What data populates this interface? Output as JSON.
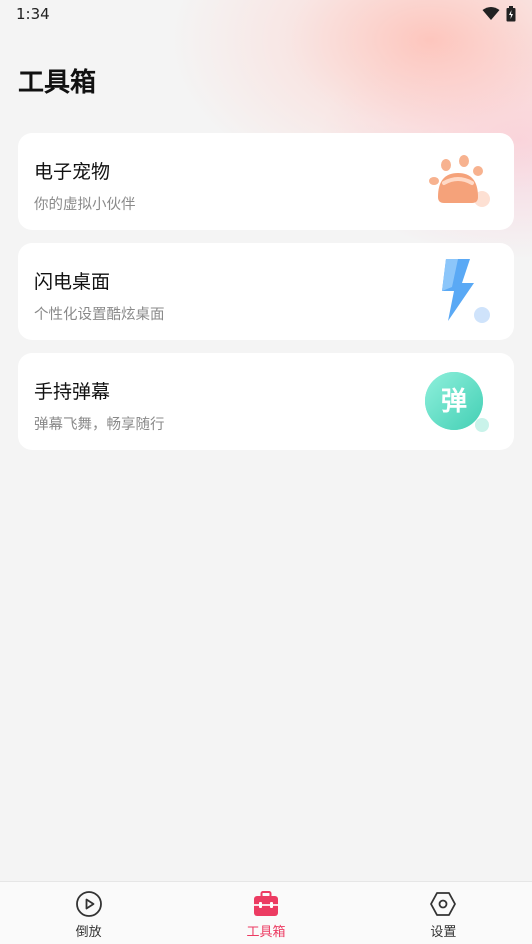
{
  "status": {
    "time": "1:34"
  },
  "page": {
    "title": "工具箱"
  },
  "tools": [
    {
      "title": "电子宠物",
      "subtitle": "你的虚拟小伙伴",
      "icon": "paw-icon"
    },
    {
      "title": "闪电桌面",
      "subtitle": "个性化设置酷炫桌面",
      "icon": "lightning-icon"
    },
    {
      "title": "手持弹幕",
      "subtitle": "弹幕飞舞，畅享随行",
      "icon": "danmu-icon",
      "icon_text": "弹"
    }
  ],
  "tabs": [
    {
      "label": "倒放",
      "icon": "play-circle-icon",
      "active": false
    },
    {
      "label": "工具箱",
      "icon": "toolbox-icon",
      "active": true
    },
    {
      "label": "设置",
      "icon": "hexagon-settings-icon",
      "active": false
    }
  ],
  "colors": {
    "accent": "#ec3b62",
    "paw": "#f5a27a",
    "lightning": "#5aa9f5",
    "danmu": "#5fe0c8"
  }
}
